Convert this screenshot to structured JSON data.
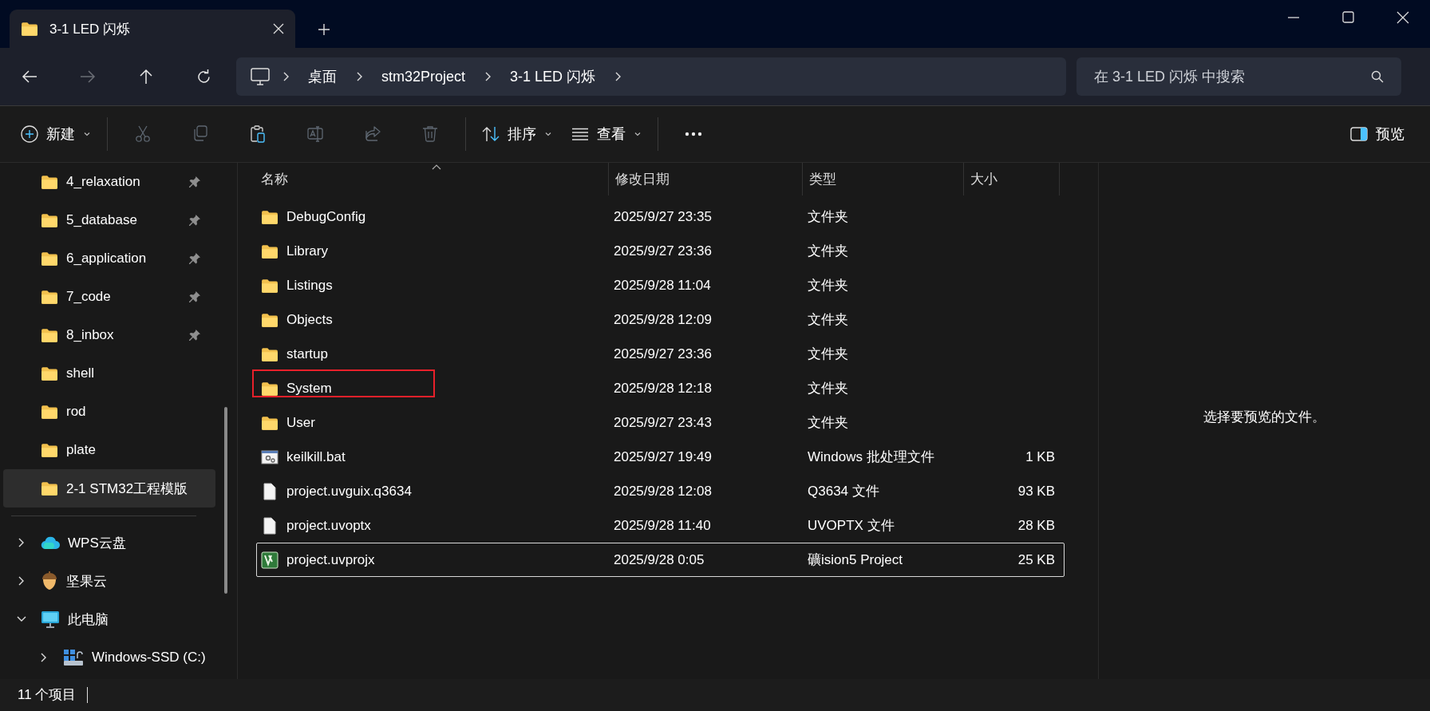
{
  "window": {
    "tab": {
      "title": "3-1 LED 闪烁"
    }
  },
  "navigation": {
    "back_enabled": true,
    "forward_enabled": false,
    "breadcrumb": [
      "桌面",
      "stm32Project",
      "3-1 LED 闪烁"
    ],
    "search": {
      "placeholder": "在 3-1 LED 闪烁 中搜索"
    }
  },
  "toolbar": {
    "new_label": "新建",
    "actions": [
      {
        "kind": "cut",
        "disabled": true
      },
      {
        "kind": "copy",
        "disabled": true
      },
      {
        "kind": "paste",
        "disabled": false
      },
      {
        "kind": "rename",
        "disabled": true
      },
      {
        "kind": "share",
        "disabled": true
      },
      {
        "kind": "delete",
        "disabled": true
      }
    ],
    "sort_label": "排序",
    "view_label": "查看",
    "preview_label": "预览"
  },
  "sidebar": {
    "items": [
      {
        "kind": "folder",
        "label": "4_relaxation",
        "pinned": true,
        "selected": false
      },
      {
        "kind": "folder",
        "label": "5_database",
        "pinned": true,
        "selected": false
      },
      {
        "kind": "folder",
        "label": "6_application",
        "pinned": true,
        "selected": false
      },
      {
        "kind": "folder",
        "label": "7_code",
        "pinned": true,
        "selected": false
      },
      {
        "kind": "folder",
        "label": "8_inbox",
        "pinned": true,
        "selected": false
      },
      {
        "kind": "folder",
        "label": "shell",
        "pinned": false,
        "selected": false
      },
      {
        "kind": "folder",
        "label": "rod",
        "pinned": false,
        "selected": false
      },
      {
        "kind": "folder",
        "label": "plate",
        "pinned": false,
        "selected": false
      },
      {
        "kind": "folder",
        "label": "2-1 STM32工程模版",
        "pinned": false,
        "selected": true
      },
      {
        "kind": "divider"
      },
      {
        "kind": "cloud",
        "label": "WPS云盘",
        "expanded": false,
        "selected": false
      },
      {
        "kind": "acorn",
        "label": "坚果云",
        "expanded": false,
        "selected": false
      },
      {
        "kind": "computer",
        "label": "此电脑",
        "expanded": true,
        "selected": false,
        "children": [
          {
            "kind": "drive",
            "label": "Windows-SSD (C:)",
            "expanded": false,
            "selected": false
          }
        ]
      }
    ]
  },
  "file_list": {
    "columns": [
      "名称",
      "修改日期",
      "类型",
      "大小"
    ],
    "rows": [
      {
        "kind": "folder",
        "name": "DebugConfig",
        "modified": "2025/9/27 23:35",
        "type": "文件夹",
        "selected": false,
        "annotated": false
      },
      {
        "kind": "folder",
        "name": "Library",
        "modified": "2025/9/27 23:36",
        "type": "文件夹",
        "selected": false,
        "annotated": false
      },
      {
        "kind": "folder",
        "name": "Listings",
        "modified": "2025/9/28 11:04",
        "type": "文件夹",
        "selected": false,
        "annotated": false
      },
      {
        "kind": "folder",
        "name": "Objects",
        "modified": "2025/9/28 12:09",
        "type": "文件夹",
        "selected": false,
        "annotated": false
      },
      {
        "kind": "folder",
        "name": "startup",
        "modified": "2025/9/27 23:36",
        "type": "文件夹",
        "selected": false,
        "annotated": false
      },
      {
        "kind": "folder",
        "name": "System",
        "modified": "2025/9/28 12:18",
        "type": "文件夹",
        "selected": false,
        "annotated": true
      },
      {
        "kind": "folder",
        "name": "User",
        "modified": "2025/9/27 23:43",
        "type": "文件夹",
        "selected": false,
        "annotated": false
      },
      {
        "kind": "script",
        "name": "keilkill.bat",
        "modified": "2025/9/27 19:49",
        "type": "Windows 批处理文件",
        "size": "1 KB",
        "selected": false,
        "annotated": false
      },
      {
        "kind": "file",
        "name": "project.uvguix.q3634",
        "modified": "2025/9/28 12:08",
        "type": "Q3634 文件",
        "size": "93 KB",
        "selected": false,
        "annotated": false
      },
      {
        "kind": "file",
        "name": "project.uvoptx",
        "modified": "2025/9/28 11:40",
        "type": "UVOPTX 文件",
        "size": "28 KB",
        "selected": false,
        "annotated": false
      },
      {
        "kind": "project",
        "name": "project.uvprojx",
        "modified": "2025/9/28 0:05",
        "type": "礦ision5 Project",
        "size": "25 KB",
        "selected": true,
        "annotated": false
      }
    ]
  },
  "preview": {
    "message": "选择要预览的文件。"
  },
  "status_bar": {
    "item_count": "11 个项目"
  }
}
